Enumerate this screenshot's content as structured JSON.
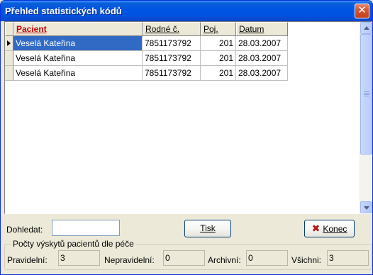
{
  "window": {
    "title": "Přehled statistických kódů",
    "close_glyph": "✕"
  },
  "grid": {
    "columns": [
      "Pacient",
      "Rodné č.",
      "Poj.",
      "Datum"
    ],
    "rows": [
      {
        "pacient": "Veselá Kateřina",
        "rodne_c": "7851173792",
        "poj": "201",
        "datum": "28.03.2007"
      },
      {
        "pacient": "Veselá Kateřina",
        "rodne_c": "7851173792",
        "poj": "201",
        "datum": "28.03.2007"
      },
      {
        "pacient": "Veselá Kateřina",
        "rodne_c": "7851173792",
        "poj": "201",
        "datum": "28.03.2007"
      }
    ]
  },
  "search": {
    "label": "Dohledat:",
    "value": ""
  },
  "buttons": {
    "print_label": "Tisk",
    "close_label": "Konec"
  },
  "counts": {
    "group_title": "Počty výskytů pacientů dle péče",
    "pravidelni_label": "Pravidelní:",
    "pravidelni_value": "3",
    "nepravidelni_label": "Nepravidelní:",
    "nepravidelni_value": "0",
    "archivni_label": "Archivní:",
    "archivni_value": "0",
    "vsichni_label": "Všichni:",
    "vsichni_value": "3"
  },
  "colors": {
    "titlebar": "#0054e3",
    "selection": "#316ac5",
    "sorted_header": "#c00000",
    "close_icon": "#b01818"
  }
}
